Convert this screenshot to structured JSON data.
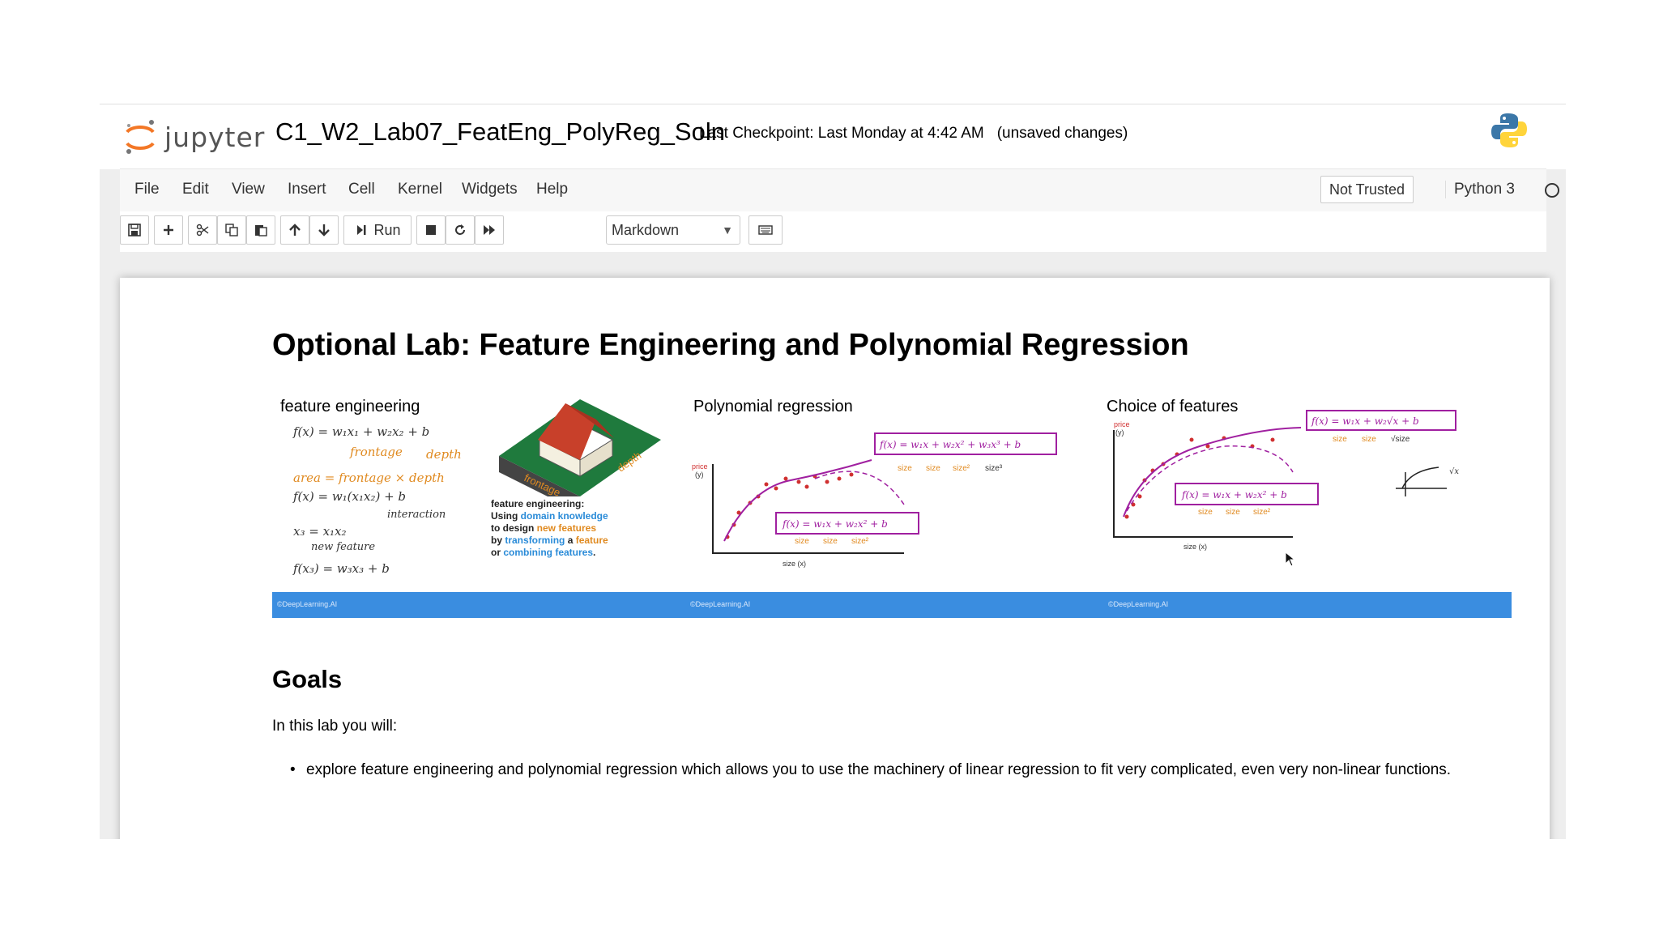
{
  "header": {
    "logo_text": "jupyter",
    "notebook_title": "C1_W2_Lab07_FeatEng_PolyReg_Soln",
    "checkpoint": "Last Checkpoint: Last Monday at 4:42 AM",
    "unsaved": "(unsaved changes)"
  },
  "menu": {
    "items": [
      "File",
      "Edit",
      "View",
      "Insert",
      "Cell",
      "Kernel",
      "Widgets",
      "Help"
    ],
    "not_trusted": "Not Trusted",
    "kernel": "Python 3"
  },
  "toolbar": {
    "run_label": "Run",
    "cell_type": "Markdown"
  },
  "notebook": {
    "title": "Optional Lab: Feature Engineering and Polynomial Regression",
    "banner": {
      "panel1_title": "feature engineering",
      "panel1_frontage": "frontage",
      "panel1_depth": "depth",
      "panel1_interaction": "interaction",
      "panel1_new_feature": "new feature",
      "panel1_caption_l1": "feature engineering:",
      "panel1_caption_l2a": "Using ",
      "panel1_caption_l2b": "domain knowledge",
      "panel1_caption_l3a": "to design ",
      "panel1_caption_l3b": "new features",
      "panel1_caption_l4a": "by ",
      "panel1_caption_l4b": "transforming",
      "panel1_caption_l4c": " a ",
      "panel1_caption_l4d": "feature",
      "panel1_caption_l5a": "or ",
      "panel1_caption_l5b": "combining features",
      "panel1_caption_l5c": ".",
      "panel2_title": "Polynomial regression",
      "panel3_title": "Choice of features",
      "price_label": "price",
      "price_unit": "(y)",
      "size_axis": "size (x)",
      "size_word": "size",
      "brand": "©DeepLearning.AI"
    },
    "goals_heading": "Goals",
    "intro": "In this lab you will:",
    "bullets": [
      "explore feature engineering and polynomial regression which allows you to use the machinery of linear regression to fit very complicated, even very non-linear functions."
    ]
  },
  "colors": {
    "jupyter_orange": "#f37726",
    "banner_blue": "#3a8de0",
    "curve_purple": "#a020a0",
    "point_red": "#d03030",
    "note_orange": "#e08a20"
  }
}
